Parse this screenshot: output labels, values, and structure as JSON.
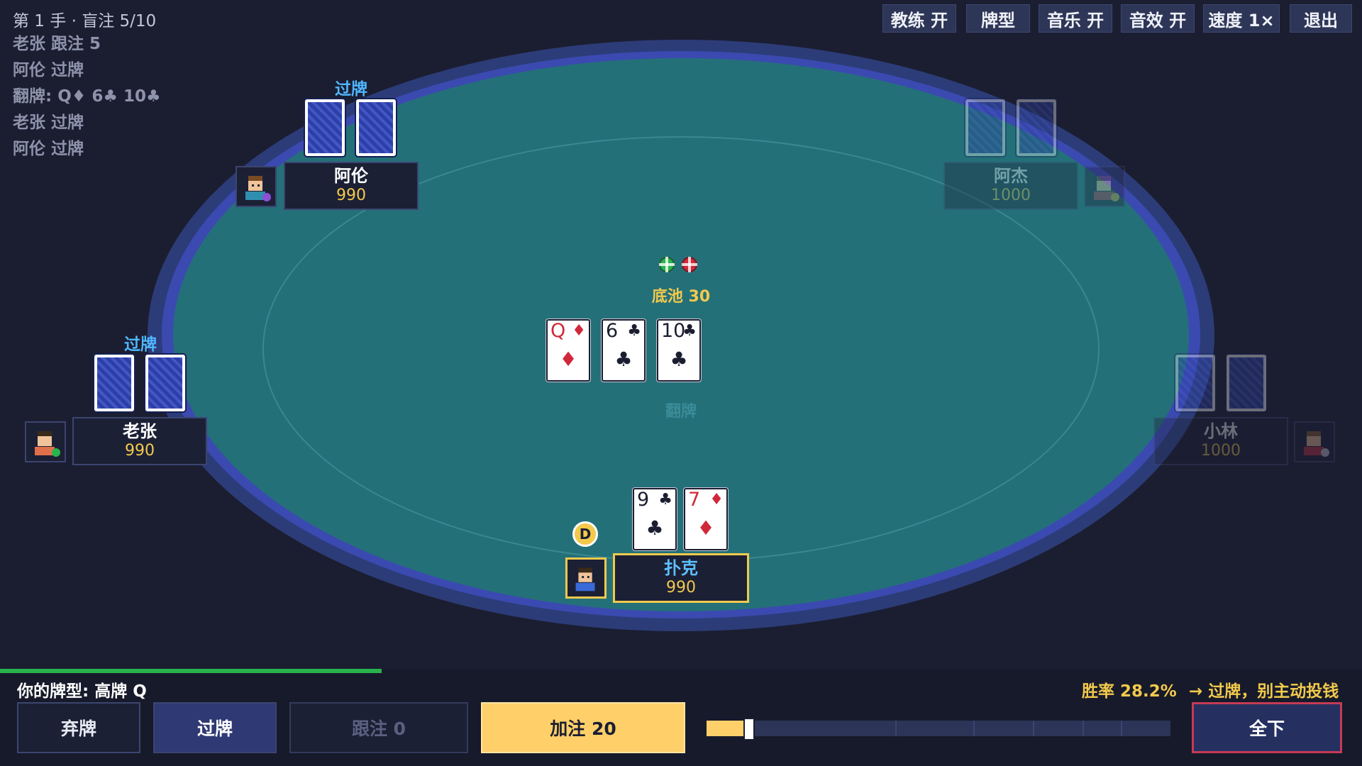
{
  "log": {
    "lines": [
      "第 1 手 · 盲注 5/10",
      "老张 跟注 5",
      "阿伦 过牌",
      "翻牌: Q♦ 6♣ 10♣",
      "老张 过牌",
      "阿伦 过牌"
    ]
  },
  "toolbar": {
    "coach": "教练 开",
    "hand_types": "牌型",
    "music": "音乐 开",
    "sfx": "音效 开",
    "speed": "速度 1×",
    "exit": "退出"
  },
  "players": {
    "alun": {
      "name": "阿伦",
      "chips": "990",
      "action": "过牌"
    },
    "ajie": {
      "name": "阿杰",
      "chips": "1000"
    },
    "laozhang": {
      "name": "老张",
      "chips": "990",
      "action": "过牌"
    },
    "xiaolin": {
      "name": "小林",
      "chips": "1000"
    },
    "hero": {
      "name": "扑克",
      "chips": "990"
    }
  },
  "board": {
    "pot_label": "底池 30",
    "stage": "翻牌",
    "cards": [
      {
        "rank": "Q",
        "suit": "♦",
        "color": "red"
      },
      {
        "rank": "6",
        "suit": "♣",
        "color": "black"
      },
      {
        "rank": "10",
        "suit": "♣",
        "color": "black"
      }
    ]
  },
  "hero_cards": [
    {
      "rank": "9",
      "suit": "♣",
      "color": "black"
    },
    {
      "rank": "7",
      "suit": "♦",
      "color": "red"
    }
  ],
  "dealer": "D",
  "panel": {
    "hand_rank": "你的牌型: 高牌 Q",
    "winrate": "胜率 28.2%",
    "advice": "→ 过牌，别主动投钱",
    "timer_fraction": 0.28,
    "raise_slider_fraction": 0.05,
    "fold": "弃牌",
    "check": "过牌",
    "call": "跟注 0",
    "raise": "加注 20",
    "allin": "全下"
  },
  "colors": {
    "felt": "#247079",
    "rail": "#3b4ab0",
    "accent_gold": "#f2c94c",
    "action_blue": "#4fb6ff",
    "allin_red": "#c63a55"
  }
}
